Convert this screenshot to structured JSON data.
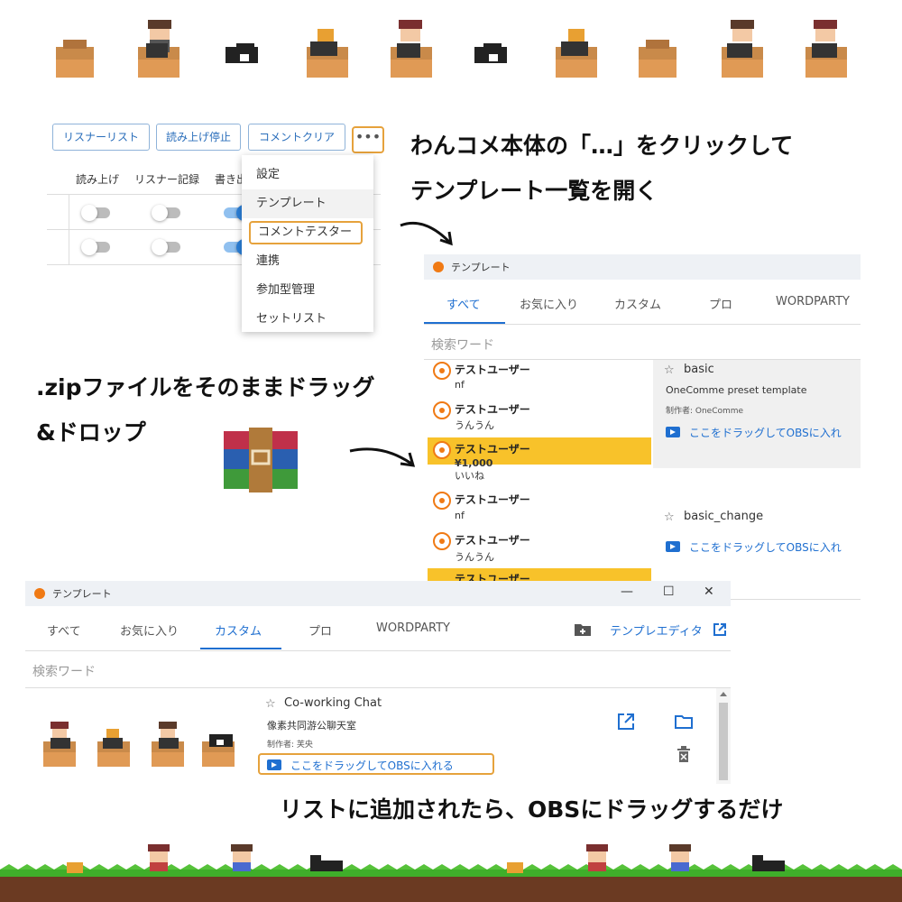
{
  "toolbar": {
    "listener_list": "リスナーリスト",
    "stop_reading": "読み上げ停止",
    "clear_comments": "コメントクリア",
    "more": "•••"
  },
  "columns": [
    "読み上げ",
    "リスナー記録",
    "書き出"
  ],
  "menu": {
    "items": [
      "設定",
      "テンプレート",
      "コメントテスター",
      "連携",
      "参加型管理",
      "セットリスト"
    ]
  },
  "captions": {
    "step1_line1": "わんコメ本体の「…」をクリックして",
    "step1_line2": "テンプレート一覧を開く",
    "step2_line1": ".zipファイルをそのままドラッグ",
    "step2_line2": "&ドロップ",
    "step3": "リストに追加されたら、OBSにドラッグするだけ"
  },
  "window_main": {
    "title": "テンプレート",
    "tabs": [
      "すべて",
      "お気に入り",
      "カスタム",
      "プロ",
      "WORDPARTY"
    ],
    "active_tab": "すべて",
    "search_placeholder": "検索ワード",
    "comments_top": [
      {
        "user": "テストユーザー",
        "text": "nf"
      },
      {
        "user": "テストユーザー",
        "text": "うんうん"
      },
      {
        "user": "テストユーザー",
        "text": "¥1,000"
      },
      {
        "user": "",
        "text": "いいね"
      }
    ],
    "comments_bottom": [
      {
        "user": "テストユーザー",
        "text": "nf"
      },
      {
        "user": "テストユーザー",
        "text": "うんうん"
      },
      {
        "user": "テストユーザー",
        "text": ""
      }
    ],
    "templates": [
      {
        "name": "basic",
        "desc": "OneComme preset template",
        "author": "制作者: OneComme",
        "drag": "ここをドラッグしてOBSに入れ"
      },
      {
        "name": "basic_change",
        "drag": "ここをドラッグしてOBSに入れ"
      }
    ]
  },
  "window_custom": {
    "title": "テンプレート",
    "controls": {
      "minimize": "—",
      "maximize": "☐",
      "close": "✕"
    },
    "tabs": [
      "すべて",
      "お気に入り",
      "カスタム",
      "プロ",
      "WORDPARTY"
    ],
    "active_tab": "カスタム",
    "editor_link": "テンプレエディタ",
    "search_placeholder": "検索ワード",
    "template": {
      "name": "Co-working Chat",
      "desc": "像素共同游公聊天室",
      "author": "制作者: 芙央",
      "drag": "ここをドラッグしてOBSに入れる"
    }
  },
  "colors": {
    "accent_blue": "#1f6fd0",
    "highlight_orange": "#e6a23c",
    "superchat_yellow": "#f8c22a",
    "grass_green": "#3fae2a",
    "dirt_brown": "#6b3a22"
  }
}
